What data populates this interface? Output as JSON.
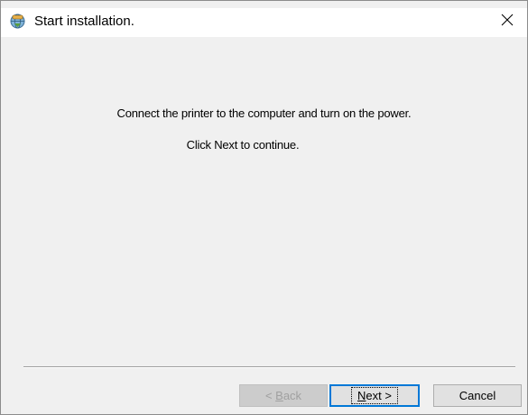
{
  "window": {
    "title": "Start installation.",
    "app_icon": "installer-globe-icon",
    "close_icon": "close-icon"
  },
  "content": {
    "message_line1": "Connect the printer to the computer and turn on the power.",
    "message_line2": "Click Next to continue."
  },
  "buttons": {
    "back": {
      "label_prefix": "< ",
      "mnemonic": "B",
      "label_rest": "ack",
      "enabled": false
    },
    "next": {
      "mnemonic": "N",
      "label_rest": "ext >",
      "enabled": true,
      "focused": true
    },
    "cancel": {
      "label": "Cancel",
      "enabled": true
    }
  },
  "colors": {
    "window_bg": "#f0f0f0",
    "titlebar_bg": "#ffffff",
    "focus_border": "#0078d7",
    "disabled_text": "#a0a0a0"
  }
}
